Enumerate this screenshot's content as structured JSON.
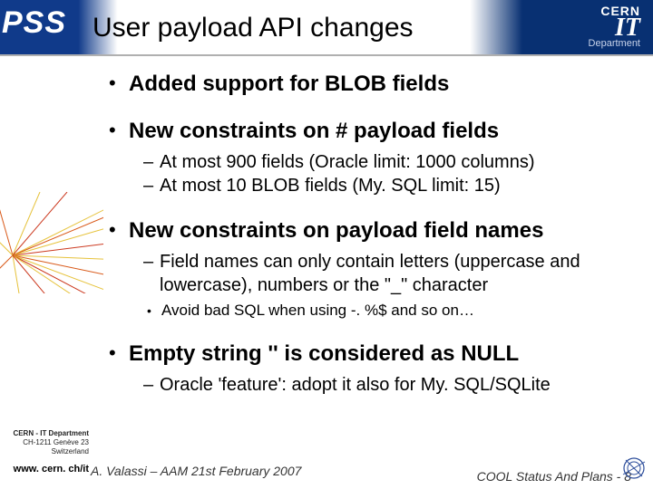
{
  "header": {
    "pss": "PSS",
    "title": "User payload API changes",
    "logo": {
      "cern": "CERN",
      "it": "IT",
      "dept": "Department"
    }
  },
  "bullets": {
    "b1": {
      "hd": "Added support for BLOB fields"
    },
    "b2": {
      "hd": "New constraints on # payload fields",
      "s1": "At most 900 fields (Oracle limit: 1000 columns)",
      "s2": "At most 10 BLOB fields (My. SQL limit: 15)"
    },
    "b3": {
      "hd": "New constraints on payload field names",
      "s1": "Field names can only contain letters (uppercase and lowercase), numbers or the \"_\" character",
      "sub1": "Avoid bad SQL when using  -. %$ and so on…"
    },
    "b4": {
      "hd": "Empty string '' is considered as NULL",
      "s1": "Oracle 'feature': adopt it also for My. SQL/SQLite"
    }
  },
  "address": {
    "l1": "CERN - IT Department",
    "l2": "CH-1211 Genève 23",
    "l3": "Switzerland",
    "url": "www. cern. ch/it"
  },
  "footer": {
    "left": "A. Valassi – AAM 21st February 2007",
    "right": "COOL Status And Plans - 8"
  }
}
